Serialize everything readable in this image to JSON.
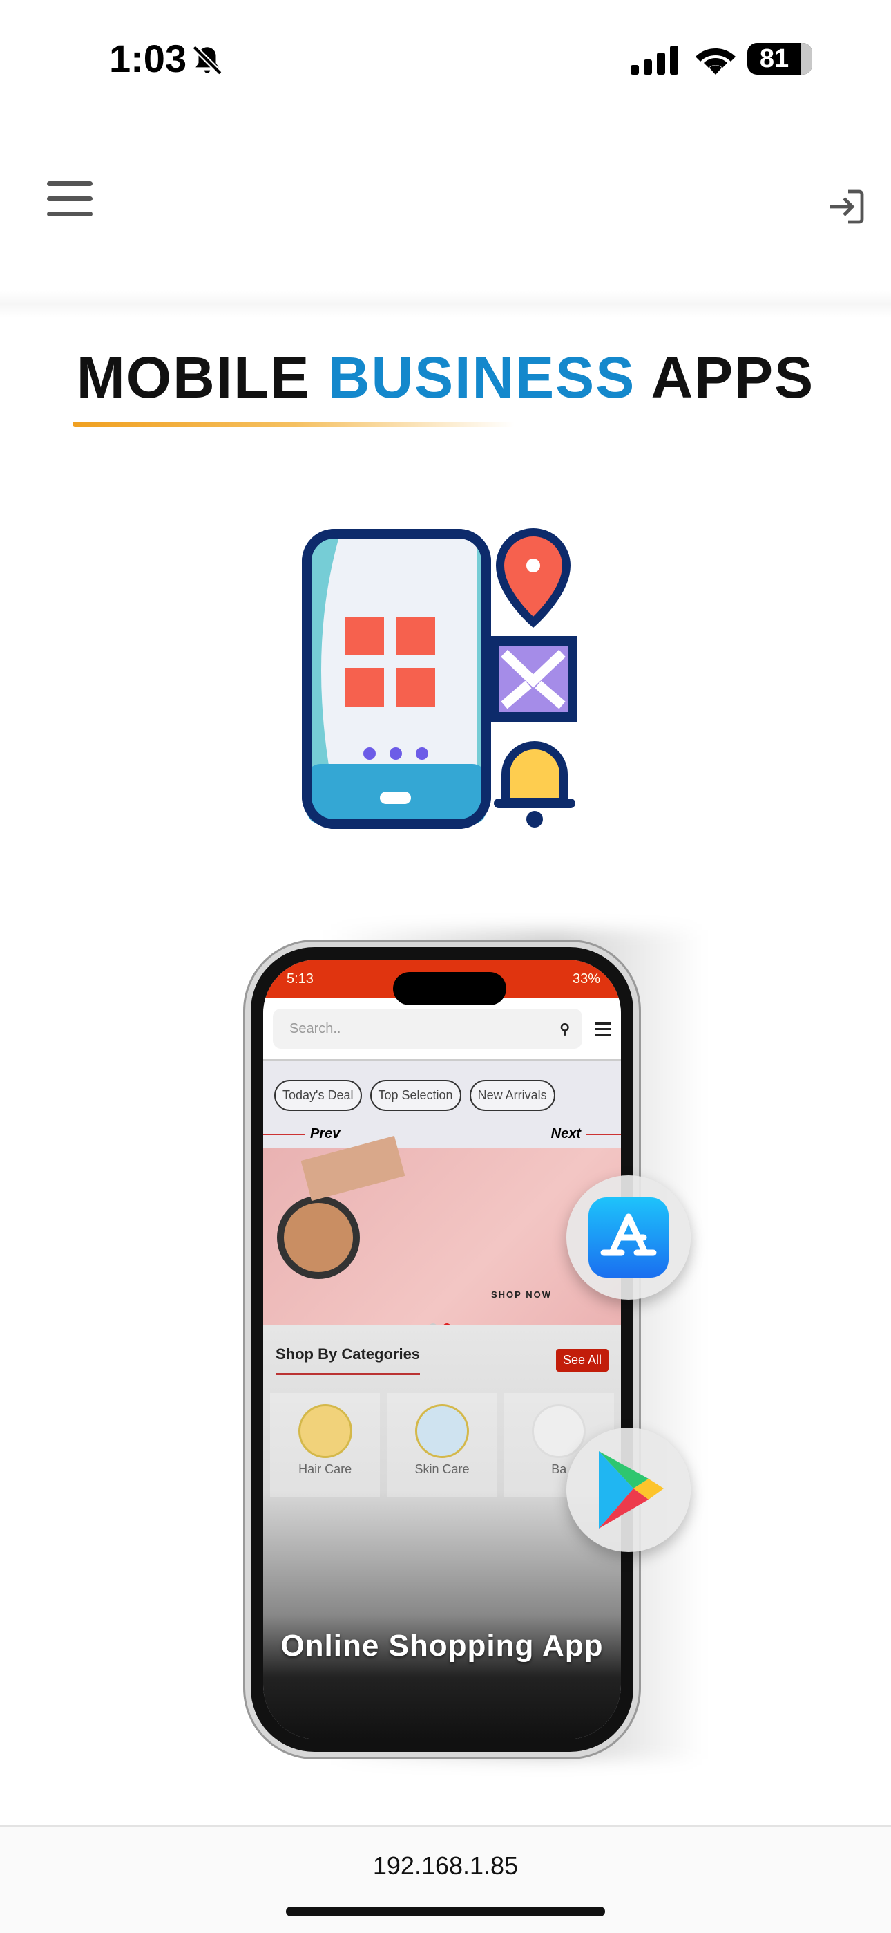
{
  "status_bar": {
    "time": "1:03",
    "battery": "81",
    "icons": [
      "bell-slash-icon",
      "signal-icon",
      "wifi-icon",
      "battery-icon"
    ]
  },
  "header": {
    "menu_icon": "hamburger-icon",
    "login_icon": "login-icon"
  },
  "hero": {
    "title_part1": "MOBILE",
    "title_part2": "BUSINESS",
    "title_part3": "APPS",
    "accent": "#1488cc",
    "underline_color": "#f0a020"
  },
  "mockup": {
    "status_time": "5:13",
    "status_battery": "33%",
    "search_placeholder": "Search..",
    "chips": [
      "Today's Deal",
      "Top Selection",
      "New Arrivals"
    ],
    "prev": "Prev",
    "next": "Next",
    "banner_cta": "SHOP NOW",
    "categories_title": "Shop By Categories",
    "see_all": "See All",
    "categories": [
      "Hair Care",
      "Skin Care",
      "Ba"
    ],
    "caption": "Online Shopping App",
    "accent": "#e0340f"
  },
  "badges": {
    "app_store": "app-store-icon",
    "play_store": "google-play-icon"
  },
  "browser": {
    "url": "192.168.1.85"
  }
}
